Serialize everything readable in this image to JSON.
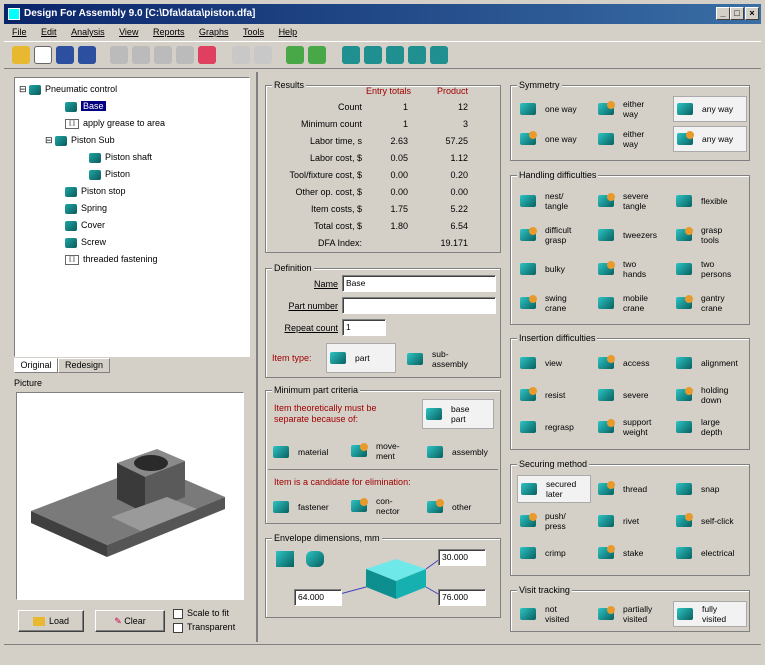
{
  "window": {
    "title": "Design For Assembly 9.0 [C:\\Dfa\\data\\piston.dfa]",
    "min": "_",
    "max": "□",
    "close": "×"
  },
  "menu": [
    "File",
    "Edit",
    "Analysis",
    "View",
    "Reports",
    "Graphs",
    "Tools",
    "Help"
  ],
  "tree": {
    "items": [
      {
        "label": "Pneumatic control",
        "icon": "assembly-icon",
        "indent": 0
      },
      {
        "label": "Base",
        "icon": "part-icon",
        "indent": 1,
        "selected": true
      },
      {
        "label": "apply grease to area",
        "icon": "operation-icon",
        "indent": 1
      },
      {
        "label": "Piston Sub",
        "icon": "subassembly-icon",
        "indent": 1
      },
      {
        "label": "Piston shaft",
        "icon": "part-icon",
        "indent": 2
      },
      {
        "label": "Piston",
        "icon": "part-icon",
        "indent": 2
      },
      {
        "label": "Piston stop",
        "icon": "part-icon",
        "indent": 1
      },
      {
        "label": "Spring",
        "icon": "part-icon",
        "indent": 1
      },
      {
        "label": "Cover",
        "icon": "part-icon",
        "indent": 1
      },
      {
        "label": "Screw",
        "icon": "part-icon",
        "indent": 1
      },
      {
        "label": "threaded fastening",
        "icon": "operation-icon",
        "indent": 1
      }
    ]
  },
  "tabs": {
    "original": "Original",
    "redesign": "Redesign"
  },
  "picture": {
    "label": "Picture",
    "load": "Load",
    "clear": "Clear",
    "scale": "Scale to fit",
    "transparent": "Transparent"
  },
  "results": {
    "label": "Results",
    "col1": "Entry totals",
    "col2": "Product",
    "rows": [
      {
        "name": "Count",
        "v1": "1",
        "v2": "12"
      },
      {
        "name": "Minimum count",
        "v1": "1",
        "v2": "3"
      },
      {
        "name": "Labor time, s",
        "v1": "2.63",
        "v2": "57.25"
      },
      {
        "name": "Labor cost, $",
        "v1": "0.05",
        "v2": "1.12"
      },
      {
        "name": "Tool/fixture cost, $",
        "v1": "0.00",
        "v2": "0.20"
      },
      {
        "name": "Other op. cost, $",
        "v1": "0.00",
        "v2": "0.00"
      },
      {
        "name": "Item costs, $",
        "v1": "1.75",
        "v2": "5.22"
      },
      {
        "name": "Total cost, $",
        "v1": "1.80",
        "v2": "6.54"
      },
      {
        "name": "DFA Index:",
        "v1": "",
        "v2": "19.171"
      }
    ]
  },
  "definition": {
    "label": "Definition",
    "name_label": "Name",
    "name_value": "Base",
    "part_label": "Part number",
    "part_value": "",
    "repeat_label": "Repeat count",
    "repeat_value": "1",
    "item_type": "Item type:",
    "part": "part",
    "sub": "sub-\nassembly"
  },
  "criteria": {
    "label": "Minimum part criteria",
    "must_sep": "Item theoretically must be\nseparate because of:",
    "base_part": "base\npart",
    "material": "material",
    "movement": "move-\nment",
    "assembly": "assembly",
    "candidate": "Item is a candidate for elimination:",
    "fastener": "fastener",
    "connector": "con-\nnector",
    "other": "other"
  },
  "envelope": {
    "label": "Envelope dimensions, mm",
    "d1": "30.000",
    "d2": "64.000",
    "d3": "76.000"
  },
  "symmetry": {
    "label": "Symmetry",
    "items": [
      "one way",
      "either\nway",
      "any way",
      "one way",
      "either\nway",
      "any way"
    ]
  },
  "handling": {
    "label": "Handling difficulties",
    "items": [
      "nest/\ntangle",
      "severe\ntangle",
      "flexible",
      "difficult\ngrasp",
      "tweezers",
      "grasp\ntools",
      "bulky",
      "two\nhands",
      "two\npersons",
      "swing\ncrane",
      "mobile\ncrane",
      "gantry\ncrane"
    ]
  },
  "insertion": {
    "label": "Insertion difficulties",
    "items": [
      "view",
      "access",
      "alignment",
      "resist",
      "severe",
      "holding\ndown",
      "regrasp",
      "support\nweight",
      "large\ndepth"
    ]
  },
  "securing": {
    "label": "Securing method",
    "items": [
      "secured\nlater",
      "thread",
      "snap",
      "push/\npress",
      "rivet",
      "self-click",
      "crimp",
      "stake",
      "electrical"
    ]
  },
  "visit": {
    "label": "Visit tracking",
    "items": [
      "not\nvisited",
      "partially\nvisited",
      "fully\nvisited"
    ]
  }
}
